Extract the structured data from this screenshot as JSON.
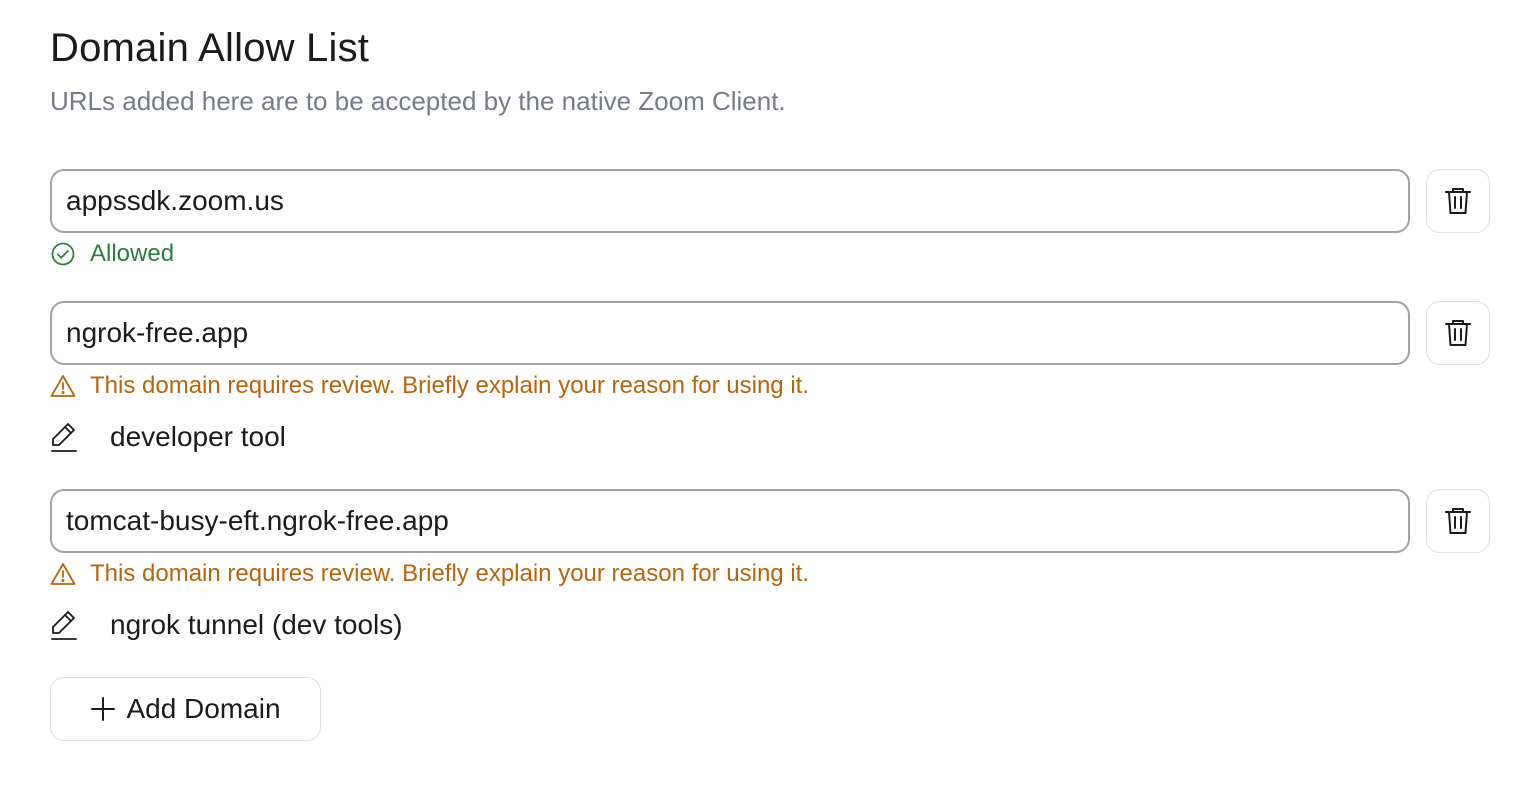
{
  "header": {
    "title": "Domain Allow List",
    "subtitle": "URLs added here are to be accepted by the native Zoom Client."
  },
  "domains": [
    {
      "value": "appssdk.zoom.us",
      "status": "Allowed",
      "status_type": "ok",
      "reason": ""
    },
    {
      "value": "ngrok-free.app",
      "status": "This domain requires review. Briefly explain your reason for using it.",
      "status_type": "warn",
      "reason": "developer tool"
    },
    {
      "value": "tomcat-busy-eft.ngrok-free.app",
      "status": "This domain requires review. Briefly explain your reason for using it.",
      "status_type": "warn",
      "reason": "ngrok tunnel (dev tools)"
    }
  ],
  "actions": {
    "add_label": "Add Domain"
  },
  "icons": {
    "delete": "trash-icon",
    "ok": "check-circle-icon",
    "warn": "warning-triangle-icon",
    "reason": "pencil-icon",
    "add": "plus-icon"
  },
  "colors": {
    "ok": "#2e7d3e",
    "warn": "#b5650d",
    "border": "#9ca3ab"
  }
}
